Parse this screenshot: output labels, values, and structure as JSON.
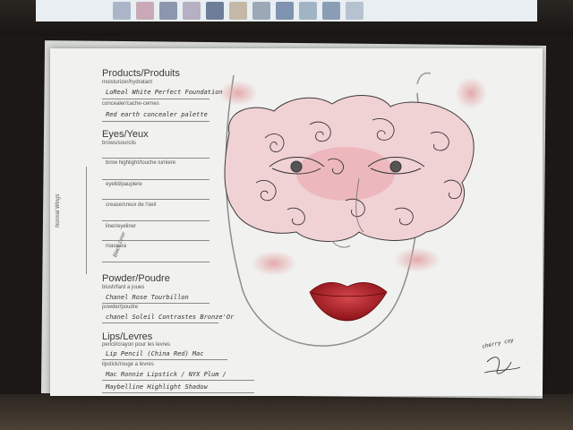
{
  "sections": {
    "products": {
      "title": "Products/Produits",
      "moisturizer_label": "moisturizer/hydratant",
      "moisturizer_value": "LoReal White Perfect Foundation",
      "concealer_label": "concealer/cache-cernes",
      "concealer_value": "Red earth concealer palette"
    },
    "eyes": {
      "title": "Eyes/Yeux",
      "brows_label": "brows/sourcils",
      "brow_highlight_label": "brow highlight/touche lumiere",
      "eyelid_label": "eyelid/paupiere",
      "crease_label": "crease/creux de l'oeil",
      "liner_label": "liner/eyeliner",
      "mascara_label": "mascara"
    },
    "powder": {
      "title": "Powder/Poudre",
      "blush_label": "blush/fard a joues",
      "blush_value": "Chanel Rose Tourbillon",
      "powder_label": "powder/poudre",
      "powder_value": "chanel Soleil Contrastes Bronze'Or"
    },
    "lips": {
      "title": "Lips/Levres",
      "pencil_label": "pencil/crayon pour les levres",
      "pencil_value": "Lip Pencil (China Red) Mac",
      "lipstick_label": "lipstick/rouge a levres",
      "lipstick_value_1": "Mac Ronnie Lipstick / NYX Plum /",
      "lipstick_value_2": "Maybelline Highlight Shadow"
    }
  },
  "side_notes": {
    "note_1": "Normal Wings",
    "note_2": "Black Liner"
  },
  "signature": {
    "name": "cherry coy"
  },
  "colors": {
    "paper": "#f1f2ef",
    "lip_red": "#a3161c",
    "rose_pink": "#e3a4ab",
    "blush": "#e7b5b8"
  }
}
